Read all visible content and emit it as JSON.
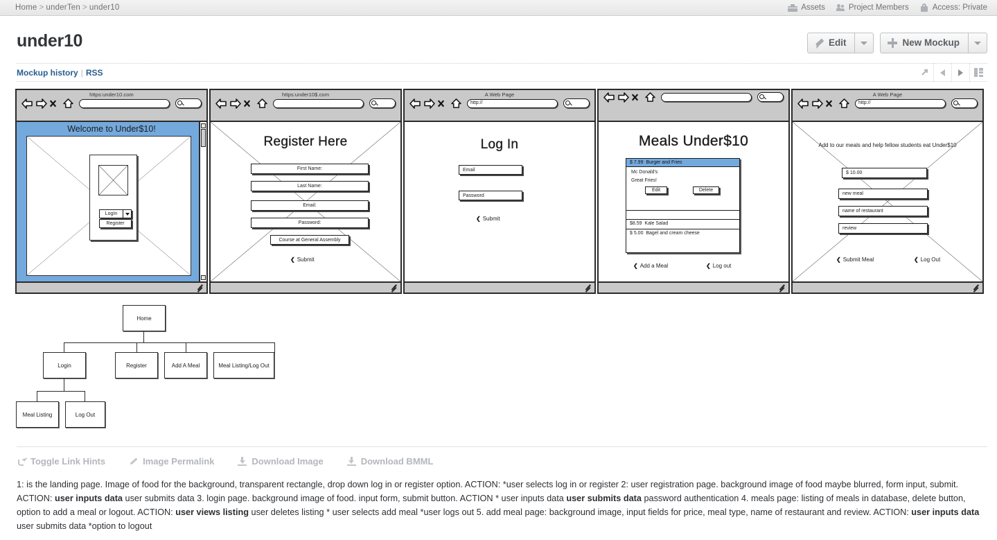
{
  "topbar": {
    "breadcrumb": [
      {
        "label": "Home"
      },
      {
        "label": "underTen"
      },
      {
        "label": "under10"
      }
    ],
    "separator": ">",
    "right_items": [
      {
        "label": "Assets",
        "icon": "briefcase-icon"
      },
      {
        "label": "Project Members",
        "icon": "people-icon"
      },
      {
        "label": "Access: Private",
        "icon": "lock-icon"
      }
    ]
  },
  "header": {
    "title": "under10",
    "edit_label": "Edit",
    "new_mockup_label": "New Mockup"
  },
  "history": {
    "mockup_history_label": "Mockup history",
    "pipe": "|",
    "rss_label": "RSS",
    "nav_icons": [
      "external-link-icon",
      "previous-icon",
      "next-icon",
      "panels-icon"
    ]
  },
  "mockups": [
    {
      "id": "mockup-landing",
      "chrome_title": "https:under10.com",
      "address_value": "",
      "heading": "Welcome to Under$10!",
      "background": "blue",
      "background_color": "#74a9dd",
      "dropdown_label": "LogIn",
      "register_label": "Register",
      "has_scrollbar": true
    },
    {
      "id": "mockup-register",
      "chrome_title": "https:under10$.com",
      "address_value": "",
      "heading": "Register Here",
      "fields": [
        "First Name:",
        "Last Name:",
        "Email:",
        "Password:"
      ],
      "course_label": "Course at General Assembly",
      "submit_label": "Submit"
    },
    {
      "id": "mockup-login",
      "chrome_title": "A Web Page",
      "address_value": "http://",
      "heading": "Log In",
      "fields": [
        "Email",
        "Password"
      ],
      "submit_label": "Submit"
    },
    {
      "id": "mockup-meals",
      "chrome_title": "",
      "address_value": "",
      "heading": "Meals Under$10",
      "selected_meal": {
        "price": "$ 7.99",
        "name": "Burger and Fries",
        "restaurant": "Mc Donald's",
        "review": "Great Fries!",
        "edit_label": "Edit",
        "delete_label": "Delete"
      },
      "rows": [
        {
          "price": "$8.59",
          "name": "Kale Salad"
        },
        {
          "price": "$ 5.00",
          "name": "Bagel and cream cheese"
        }
      ],
      "links": [
        "Add a Meal",
        "Log out"
      ]
    },
    {
      "id": "mockup-addmeal",
      "chrome_title": "A Web Page",
      "address_value": "http://",
      "heading": "Add to our meals and help fellow students eat Under$10",
      "fields": [
        "$ 10.00",
        "new meal",
        "name of restaurant",
        "review"
      ],
      "links": [
        "Submit Meal",
        "Log Out"
      ]
    }
  ],
  "sitemap": {
    "nodes": [
      {
        "id": "home",
        "label": "Home"
      },
      {
        "id": "login",
        "label": "Login"
      },
      {
        "id": "register",
        "label": "Register"
      },
      {
        "id": "addameal",
        "label": "Add A Meal"
      },
      {
        "id": "meallisting-logout",
        "label": "Meal Listing/Log Out"
      },
      {
        "id": "meallisting",
        "label": "Meal Listing"
      },
      {
        "id": "logout",
        "label": "Log Out"
      }
    ]
  },
  "footer_tools": [
    {
      "label": "Toggle Link Hints",
      "icon": "share-arrow-icon"
    },
    {
      "label": "Image Permalink",
      "icon": "link-icon"
    },
    {
      "label": "Download Image",
      "icon": "download-icon"
    },
    {
      "label": "Download BMML",
      "icon": "download-icon"
    }
  ],
  "description": {
    "parts": [
      {
        "text": "1: is the landing page. Image of food for the background, transparent rectangle, drop down log in or register option. ACTION: *user selects log in or register 2: user registration page. background image of food maybe blurred, form input, submit. ACTION: ",
        "bold": false
      },
      {
        "text": "user inputs data",
        "bold": true
      },
      {
        "text": " user submits data 3. login page. background image of food. input form, submit button. ACTION * user inputs data ",
        "bold": false
      },
      {
        "text": "user submits data",
        "bold": true
      },
      {
        "text": " password authentication 4. meals page: listing of meals in database, delete button, option to add a meal or logout. ACTION: ",
        "bold": false
      },
      {
        "text": "user views listing",
        "bold": true
      },
      {
        "text": " user deletes listing * user selects add meal *user logs out 5. add meal page: background image, input fields for price, meal type, name of restaurant and review. ACTION: ",
        "bold": false
      },
      {
        "text": "user inputs data",
        "bold": true
      },
      {
        "text": " user submits data *option to logout",
        "bold": false
      }
    ]
  },
  "colors": {
    "accent_blue": "#74a9dd",
    "link_blue": "#2a5d8f",
    "chrome_gray": "#c9c9c9",
    "topbar_gray": "#e6e6e6"
  }
}
